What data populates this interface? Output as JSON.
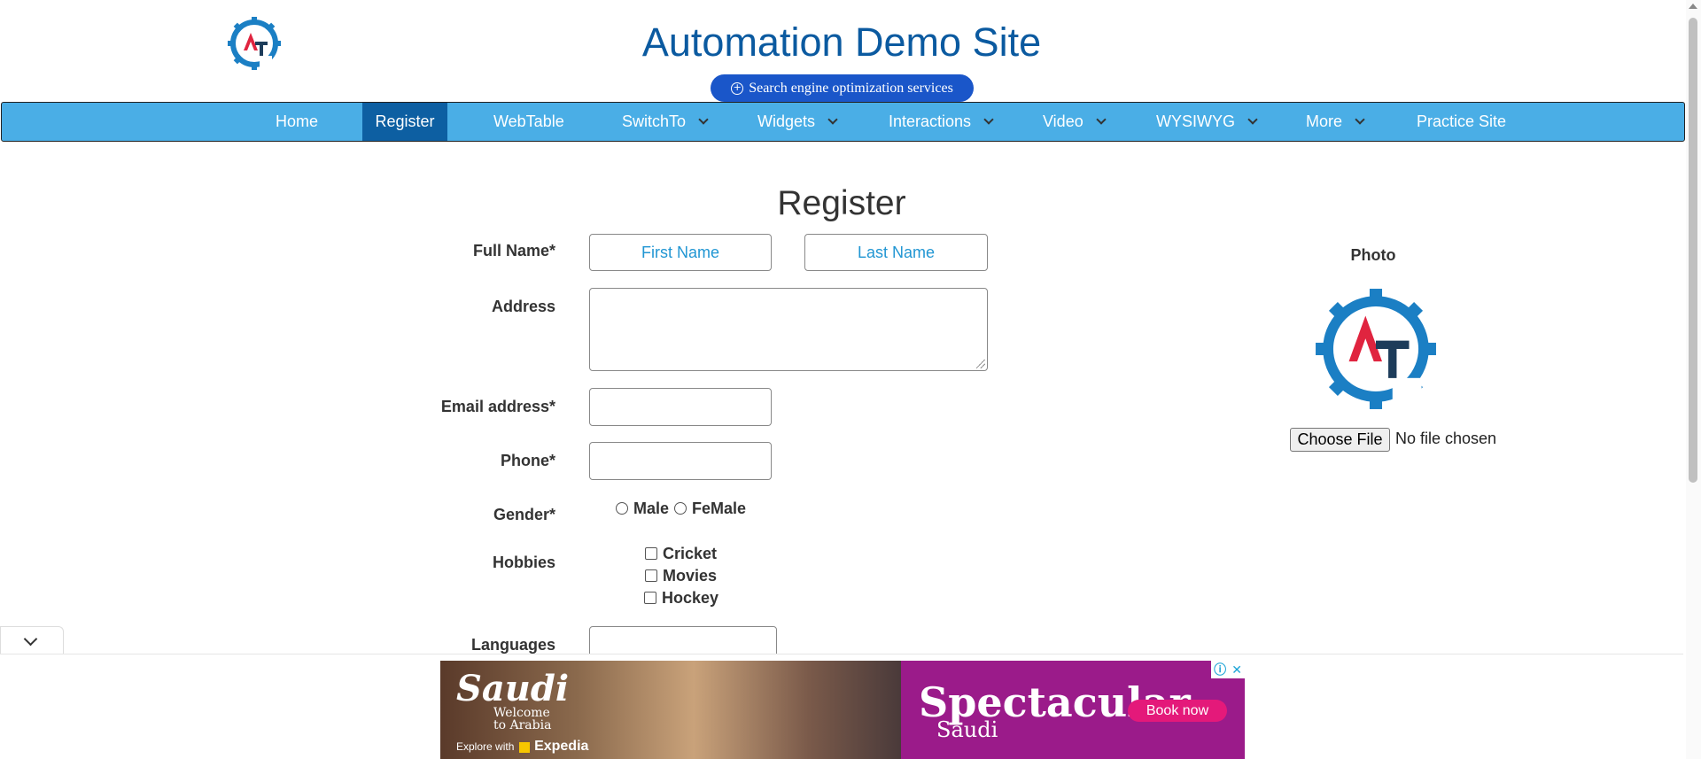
{
  "header": {
    "site_title": "Automation Demo Site",
    "seo_button": "Search engine optimization services",
    "logo_letters": "AT"
  },
  "nav": {
    "items": [
      {
        "label": "Home",
        "dropdown": false
      },
      {
        "label": "Register",
        "dropdown": false,
        "active": true
      },
      {
        "label": "WebTable",
        "dropdown": false
      },
      {
        "label": "SwitchTo",
        "dropdown": true
      },
      {
        "label": "Widgets",
        "dropdown": true
      },
      {
        "label": "Interactions",
        "dropdown": true
      },
      {
        "label": "Video",
        "dropdown": true
      },
      {
        "label": "WYSIWYG",
        "dropdown": true
      },
      {
        "label": "More",
        "dropdown": true
      },
      {
        "label": "Practice Site",
        "dropdown": false
      }
    ]
  },
  "form": {
    "heading": "Register",
    "full_name_label": "Full Name*",
    "first_name_placeholder": "First Name",
    "last_name_placeholder": "Last Name",
    "address_label": "Address",
    "email_label": "Email address*",
    "phone_label": "Phone*",
    "gender_label": "Gender*",
    "gender_options": [
      "Male",
      "FeMale"
    ],
    "hobbies_label": "Hobbies",
    "hobbies_options": [
      "Cricket",
      "Movies",
      "Hockey"
    ],
    "languages_label": "Languages"
  },
  "photo": {
    "label": "Photo",
    "choose_file": "Choose File",
    "no_file": "No file chosen"
  },
  "ad": {
    "brand": "Saudi",
    "welcome": "Welcome to Arabia",
    "explore": "Explore with",
    "partner": "Expedia",
    "headline": "Spectacular",
    "sub": "Saudi",
    "cta": "Book now"
  },
  "colors": {
    "nav_bg": "#4aaee6",
    "nav_active": "#0d5fa2",
    "title": "#0b5aa0",
    "seo_pill": "#1a56c9",
    "placeholder": "#2196d3",
    "ad_purple": "#9b1b8a",
    "ad_cta": "#e4197a"
  }
}
